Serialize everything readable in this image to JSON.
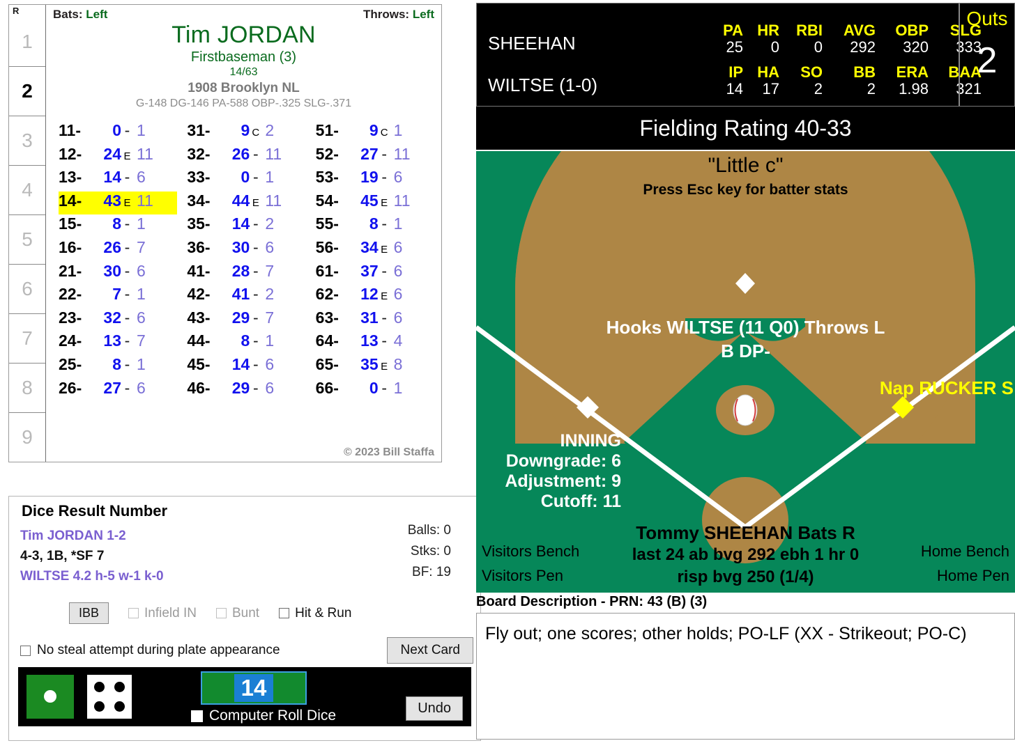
{
  "player_card": {
    "runner_header": "R",
    "runner_cells": [
      "1",
      "2",
      "3",
      "4",
      "5",
      "6",
      "7",
      "8",
      "9"
    ],
    "active_runner": "2",
    "bats_label": "Bats:",
    "bats_value": "Left",
    "throws_label": "Throws:",
    "throws_value": "Left",
    "name": "Tim JORDAN",
    "position": "Firstbaseman (3)",
    "fraction": "14/63",
    "team": "1908 Brooklyn NL",
    "stats": "G-148 DG-146 PA-588 OBP-.325 SLG-.371",
    "copyright": "© 2023 Bill Staffa",
    "highlight_key": "14-",
    "rows": [
      {
        "key": "11-",
        "main": "0",
        "sep": "-",
        "tail": "1"
      },
      {
        "key": "12-",
        "main": "24",
        "sep": "E",
        "tail": "11"
      },
      {
        "key": "13-",
        "main": "14",
        "sep": "-",
        "tail": "6"
      },
      {
        "key": "14-",
        "main": "43",
        "sep": "E",
        "tail": "11"
      },
      {
        "key": "15-",
        "main": "8",
        "sep": "-",
        "tail": "1"
      },
      {
        "key": "16-",
        "main": "26",
        "sep": "-",
        "tail": "7"
      },
      {
        "key": "21-",
        "main": "30",
        "sep": "-",
        "tail": "6"
      },
      {
        "key": "22-",
        "main": "7",
        "sep": "-",
        "tail": "1"
      },
      {
        "key": "23-",
        "main": "32",
        "sep": "-",
        "tail": "6"
      },
      {
        "key": "24-",
        "main": "13",
        "sep": "-",
        "tail": "7"
      },
      {
        "key": "25-",
        "main": "8",
        "sep": "-",
        "tail": "1"
      },
      {
        "key": "26-",
        "main": "27",
        "sep": "-",
        "tail": "6"
      },
      {
        "key": "31-",
        "main": "9",
        "sep": "C",
        "tail": "2"
      },
      {
        "key": "32-",
        "main": "26",
        "sep": "-",
        "tail": "11"
      },
      {
        "key": "33-",
        "main": "0",
        "sep": "-",
        "tail": "1"
      },
      {
        "key": "34-",
        "main": "44",
        "sep": "E",
        "tail": "11"
      },
      {
        "key": "35-",
        "main": "14",
        "sep": "-",
        "tail": "2"
      },
      {
        "key": "36-",
        "main": "30",
        "sep": "-",
        "tail": "6"
      },
      {
        "key": "41-",
        "main": "28",
        "sep": "-",
        "tail": "7"
      },
      {
        "key": "42-",
        "main": "41",
        "sep": "-",
        "tail": "2"
      },
      {
        "key": "43-",
        "main": "29",
        "sep": "-",
        "tail": "7"
      },
      {
        "key": "44-",
        "main": "8",
        "sep": "-",
        "tail": "1"
      },
      {
        "key": "45-",
        "main": "14",
        "sep": "-",
        "tail": "6"
      },
      {
        "key": "46-",
        "main": "29",
        "sep": "-",
        "tail": "6"
      },
      {
        "key": "51-",
        "main": "9",
        "sep": "C",
        "tail": "1"
      },
      {
        "key": "52-",
        "main": "27",
        "sep": "-",
        "tail": "11"
      },
      {
        "key": "53-",
        "main": "19",
        "sep": "-",
        "tail": "6"
      },
      {
        "key": "54-",
        "main": "45",
        "sep": "E",
        "tail": "11"
      },
      {
        "key": "55-",
        "main": "8",
        "sep": "-",
        "tail": "1"
      },
      {
        "key": "56-",
        "main": "34",
        "sep": "E",
        "tail": "6"
      },
      {
        "key": "61-",
        "main": "37",
        "sep": "-",
        "tail": "6"
      },
      {
        "key": "62-",
        "main": "12",
        "sep": "E",
        "tail": "6"
      },
      {
        "key": "63-",
        "main": "31",
        "sep": "-",
        "tail": "6"
      },
      {
        "key": "64-",
        "main": "13",
        "sep": "-",
        "tail": "4"
      },
      {
        "key": "65-",
        "main": "35",
        "sep": "E",
        "tail": "8"
      },
      {
        "key": "66-",
        "main": "0",
        "sep": "-",
        "tail": "1"
      }
    ]
  },
  "dice_panel": {
    "title": "Dice Result Number",
    "line1": "Tim JORDAN  1-2",
    "line2": "4-3, 1B, *SF 7",
    "line3": "WILTSE  4.2  h-5  w-1  k-0",
    "balls": "Balls: 0",
    "strikes": "Stks: 0",
    "bf": "BF: 19",
    "ibb_label": "IBB",
    "infield_in_label": "Infield IN",
    "bunt_label": "Bunt",
    "hit_run_label": "Hit & Run",
    "no_steal_label": "No steal attempt during plate appearance",
    "next_card_label": "Next Card",
    "computer_roll_label": "Computer Roll Dice",
    "undo_label": "Undo",
    "result_number": "14",
    "green_die_value": "1",
    "white_die_value": "4"
  },
  "scoreboard": {
    "batter_name": "SHEEHAN",
    "batter_headers": [
      "PA",
      "HR",
      "RBI",
      "AVG",
      "OBP",
      "SLG"
    ],
    "batter_values": [
      "25",
      "0",
      "0",
      "292",
      "320",
      "333"
    ],
    "pitcher_name": "WILTSE (1-0)",
    "pitcher_headers": [
      "IP",
      "HA",
      "SO",
      "BB",
      "ERA",
      "BAA"
    ],
    "pitcher_values": [
      "14",
      "17",
      "2",
      "2",
      "1.98",
      "321"
    ],
    "outs_label": "Outs",
    "outs_value": "2",
    "accent_color": "#ffff00"
  },
  "fielding": {
    "bar_text": "Fielding Rating 40-33"
  },
  "field": {
    "little_c": "\"Little c\"",
    "esc_hint": "Press Esc key for batter stats",
    "pitcher_line1": "Hooks WILTSE (11 Q0) Throws L",
    "pitcher_line2": "B DP-",
    "right_fielder": "Nap RUCKER S",
    "inning_label": "INNING",
    "downgrade": "Downgrade: 6",
    "adjustment": "Adjustment: 9",
    "cutoff": "Cutoff: 11",
    "batter_line1": "Tommy SHEEHAN Bats R",
    "batter_line2": "last 24 ab bvg 292 ebh 1 hr 0",
    "batter_line3": "risp bvg 250 (1/4)",
    "visitors_bench": "Visitors Bench",
    "visitors_pen": "Visitors Pen",
    "home_bench": "Home Bench",
    "home_pen": "Home Pen",
    "grass_color": "#068759",
    "dirt_color": "#ae8645"
  },
  "board_description": {
    "title": "Board Description - PRN: 43 (B) (3)",
    "body": "Fly out; one scores; other holds; PO-LF (XX - Strikeout; PO-C)"
  }
}
